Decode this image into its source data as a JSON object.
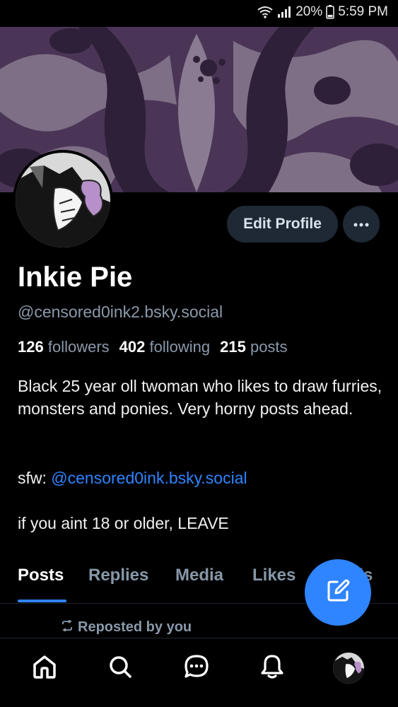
{
  "status_bar": {
    "battery": "20%",
    "time": "5:59 PM"
  },
  "profile": {
    "display_name": "Inkie Pie",
    "handle": "@censored0ink2.bsky.social",
    "edit_label": "Edit Profile",
    "more_icon": "ellipsis-icon"
  },
  "stats": {
    "followers_count": "126",
    "followers_label": "followers",
    "following_count": "402",
    "following_label": "following",
    "posts_count": "215",
    "posts_label": "posts"
  },
  "bio": {
    "line1": "Black 25 year oll twoman who likes to draw furries, monsters and ponies. Very horny posts ahead.",
    "sfw_prefix": "sfw: ",
    "sfw_link": "@censored0ink.bsky.social",
    "line3": "if you aint 18 or older, LEAVE"
  },
  "tabs": [
    {
      "label": "Posts",
      "active": true
    },
    {
      "label": "Replies",
      "active": false
    },
    {
      "label": "Media",
      "active": false
    },
    {
      "label": "Likes",
      "active": false
    },
    {
      "label": "Feeds",
      "active": false
    }
  ],
  "feed": {
    "repost_label": "Reposted by you"
  },
  "bottom_nav": [
    "home-icon",
    "search-icon",
    "chat-icon",
    "notifications-bell-icon",
    "profile-avatar"
  ],
  "colors": {
    "accent": "#2f84ff",
    "button_bg": "#1e2935",
    "muted_text": "#8a99aa",
    "banner_purple": "#4a3557"
  }
}
